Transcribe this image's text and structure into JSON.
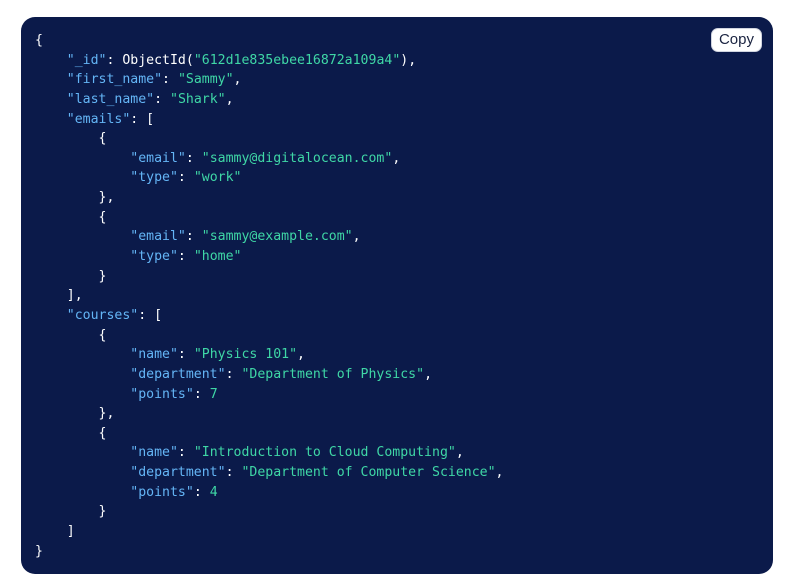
{
  "toolbar": {
    "copy_label": "Copy"
  },
  "colors": {
    "panel_background": "#0b1a4a",
    "key": "#64b5f6",
    "string": "#3fd7a6",
    "punctuation": "#ffffff"
  },
  "document": {
    "id_key": "\"_id\"",
    "id_func": "ObjectId(",
    "id_value": "\"612d1e835ebee16872a109a4\"",
    "first_name_key": "\"first_name\"",
    "first_name_value": "\"Sammy\"",
    "last_name_key": "\"last_name\"",
    "last_name_value": "\"Shark\"",
    "emails_key": "\"emails\"",
    "email_key": "\"email\"",
    "type_key": "\"type\"",
    "emails": [
      {
        "email": "\"sammy@digitalocean.com\"",
        "type": "\"work\""
      },
      {
        "email": "\"sammy@example.com\"",
        "type": "\"home\""
      }
    ],
    "courses_key": "\"courses\"",
    "name_key": "\"name\"",
    "department_key": "\"department\"",
    "points_key": "\"points\"",
    "courses": [
      {
        "name": "\"Physics 101\"",
        "department": "\"Department of Physics\"",
        "points": "7"
      },
      {
        "name": "\"Introduction to Cloud Computing\"",
        "department": "\"Department of Computer Science\"",
        "points": "4"
      }
    ]
  }
}
